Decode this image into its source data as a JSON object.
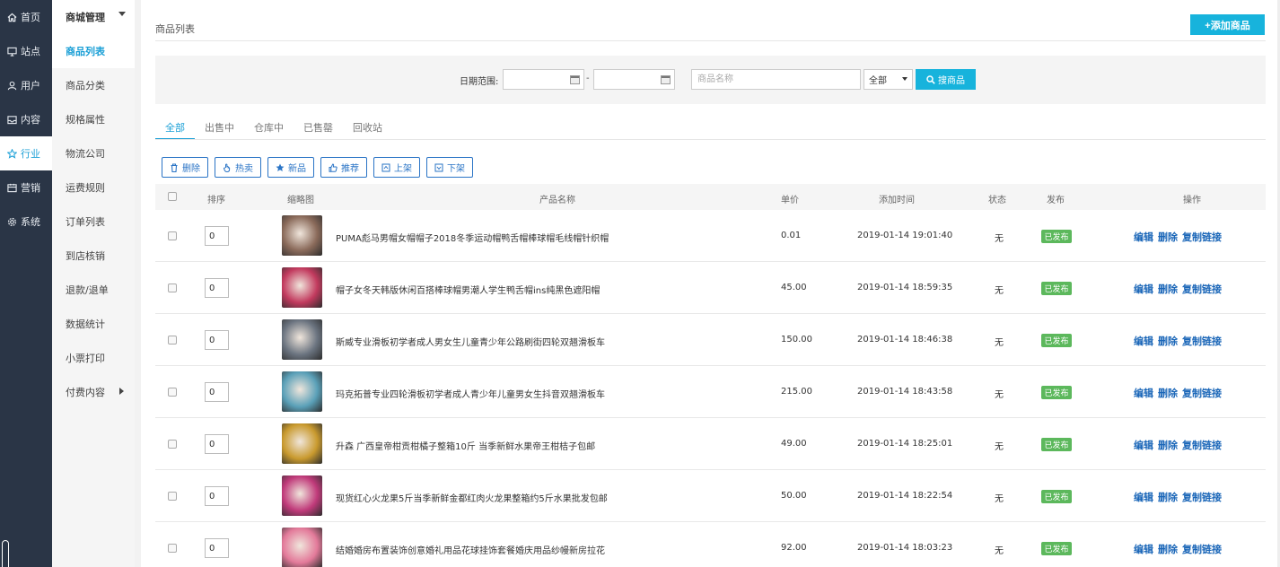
{
  "nav1": {
    "items": [
      {
        "label": "首页",
        "icon": "home-icon",
        "active": false
      },
      {
        "label": "站点",
        "icon": "monitor-icon",
        "active": false
      },
      {
        "label": "用户",
        "icon": "user-icon",
        "active": false
      },
      {
        "label": "内容",
        "icon": "inbox-icon",
        "active": false
      },
      {
        "label": "行业",
        "icon": "star-icon",
        "active": true
      },
      {
        "label": "营销",
        "icon": "calendar-icon",
        "active": false
      },
      {
        "label": "系统",
        "icon": "gear-icon",
        "active": false
      }
    ]
  },
  "nav2": {
    "header": "商城管理",
    "items": [
      {
        "label": "商品列表",
        "active": true
      },
      {
        "label": "商品分类",
        "active": false
      },
      {
        "label": "规格属性",
        "active": false
      },
      {
        "label": "物流公司",
        "active": false
      },
      {
        "label": "运费规则",
        "active": false
      },
      {
        "label": "订单列表",
        "active": false
      },
      {
        "label": "到店核销",
        "active": false
      },
      {
        "label": "退款/退单",
        "active": false
      },
      {
        "label": "数据统计",
        "active": false
      },
      {
        "label": "小票打印",
        "active": false
      }
    ],
    "last": "付费内容"
  },
  "main": {
    "title": "商品列表",
    "add_label": "+添加商品"
  },
  "filter": {
    "date_label": "日期范围:",
    "date_dash": "-",
    "name_placeholder": "商品名称",
    "status_value": "全部",
    "search_label": "搜商品"
  },
  "tabs": [
    "全部",
    "出售中",
    "仓库中",
    "已售罄",
    "回收站"
  ],
  "actions": [
    {
      "label": "删除",
      "icon": "trash-icon",
      "name": "delete-button"
    },
    {
      "label": "热卖",
      "icon": "hand-icon",
      "name": "hot-sale-button"
    },
    {
      "label": "新品",
      "icon": "star-icon",
      "name": "new-product-button"
    },
    {
      "label": "推荐",
      "icon": "thumbs-up-icon",
      "name": "recommend-button"
    },
    {
      "label": "上架",
      "icon": "shelf-up-icon",
      "name": "list-button"
    },
    {
      "label": "下架",
      "icon": "shelf-down-icon",
      "name": "delist-button"
    }
  ],
  "table": {
    "headers": {
      "sort": "排序",
      "thumb": "缩略图",
      "name": "产品名称",
      "price": "单价",
      "time": "添加时间",
      "status": "状态",
      "publish": "发布",
      "ops": "操作"
    },
    "rows": [
      {
        "sort": "0",
        "name": "PUMA彪马男帽女帽帽子2018冬季运动帽鸭舌帽棒球帽毛线帽针织帽",
        "price": "0.01",
        "time": "2019-01-14 19:01:40",
        "status": "无",
        "publish": "已发布",
        "thumb_color": "#8a6a5a"
      },
      {
        "sort": "0",
        "name": "帽子女冬天韩版休闲百搭棒球帽男潮人学生鸭舌帽ins纯黑色遮阳帽",
        "price": "45.00",
        "time": "2019-01-14 18:59:35",
        "status": "无",
        "publish": "已发布",
        "thumb_color": "#c23a5e"
      },
      {
        "sort": "0",
        "name": "斯威专业滑板初学者成人男女生儿童青少年公路刷街四轮双翘滑板车",
        "price": "150.00",
        "time": "2019-01-14 18:46:38",
        "status": "无",
        "publish": "已发布",
        "thumb_color": "#6b7480"
      },
      {
        "sort": "0",
        "name": "玛克拓普专业四轮滑板初学者成人青少年儿童男女生抖音双翘滑板车",
        "price": "215.00",
        "time": "2019-01-14 18:43:58",
        "status": "无",
        "publish": "已发布",
        "thumb_color": "#5aa0b8"
      },
      {
        "sort": "0",
        "name": "升森 广西皇帝柑贡柑橘子整箱10斤 当季新鲜水果帝王柑桔子包邮",
        "price": "49.00",
        "time": "2019-01-14 18:25:01",
        "status": "无",
        "publish": "已发布",
        "thumb_color": "#c99a2e"
      },
      {
        "sort": "0",
        "name": "现货红心火龙果5斤当季新鲜金都红肉火龙果整箱约5斤水果批发包邮",
        "price": "50.00",
        "time": "2019-01-14 18:22:54",
        "status": "无",
        "publish": "已发布",
        "thumb_color": "#c03a7a"
      },
      {
        "sort": "0",
        "name": "结婚婚房布置装饰创意婚礼用品花球挂饰套餐婚庆用品纱幔新房拉花",
        "price": "92.00",
        "time": "2019-01-14 18:03:23",
        "status": "无",
        "publish": "已发布",
        "thumb_color": "#e37a9a"
      }
    ],
    "ops": [
      "编辑",
      "删除",
      "复制链接"
    ]
  }
}
